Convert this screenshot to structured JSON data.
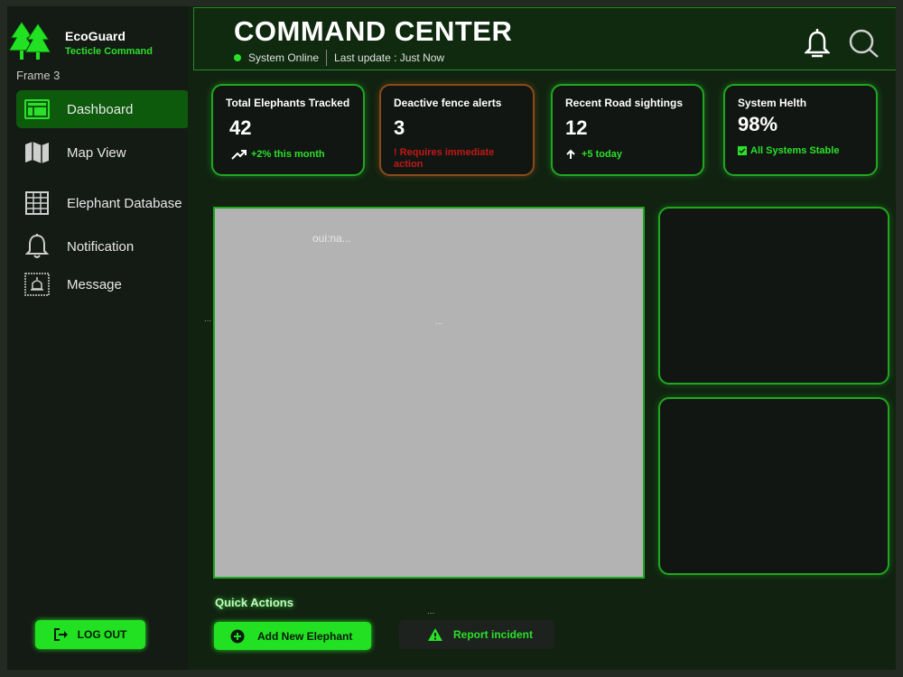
{
  "sidebar": {
    "brand_name": "EcoGuard",
    "brand_sub": "Tecticle Command",
    "frame_label": "Frame 3",
    "items": [
      {
        "label": "Dashboard",
        "icon": "dashboard-icon",
        "active": true
      },
      {
        "label": "Map View",
        "icon": "map-icon"
      },
      {
        "label": "Elephant Database",
        "icon": "grid-icon"
      },
      {
        "label": "Notification",
        "icon": "bell-icon"
      },
      {
        "label": "Message",
        "icon": "message-icon"
      }
    ],
    "logout_label": "LOG OUT"
  },
  "header": {
    "title": "COMMAND CENTER",
    "status": "System Online",
    "last_update": "Last update : Just Now"
  },
  "cards": [
    {
      "title": "Total Elephants Tracked",
      "value": "42",
      "note": "+2% this month"
    },
    {
      "title": "Deactive fence alerts",
      "value": "3",
      "note": "! Requires immediate action"
    },
    {
      "title": "Recent Road sightings",
      "value": "12",
      "note": "+5 today"
    },
    {
      "title": "System Helth",
      "value": "98%",
      "note": "All Systems Stable"
    }
  ],
  "map": {
    "text": "oui:na...",
    "dots": "...",
    "side_dots": "..."
  },
  "quick_actions": {
    "title": "Quick Actions",
    "dots": "...",
    "add_label": "Add New Elephant",
    "report_label": "Report incident"
  },
  "colors": {
    "accent": "#2be02b",
    "alert": "#c01818",
    "panel": "#121612"
  }
}
